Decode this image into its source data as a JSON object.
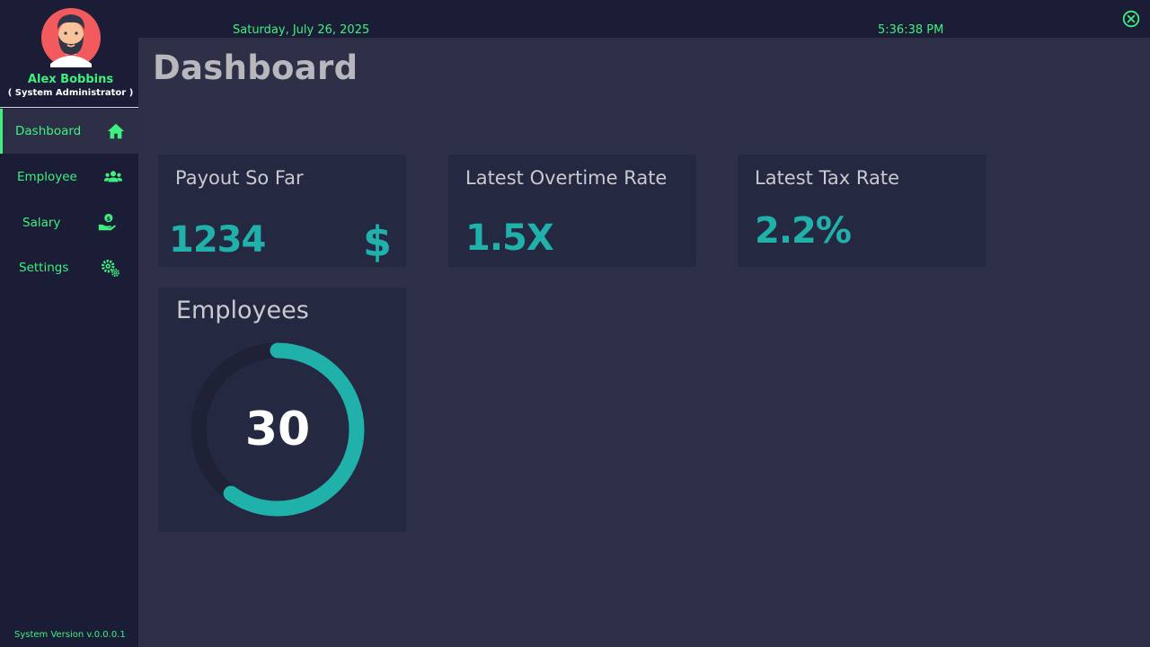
{
  "user": {
    "name": "Alex Bobbins",
    "role": "( System Administrator )"
  },
  "nav": {
    "items": [
      {
        "label": "Dashboard",
        "icon": "home-icon",
        "active": true
      },
      {
        "label": "Employee",
        "icon": "users-icon",
        "active": false
      },
      {
        "label": "Salary",
        "icon": "hand-money-icon",
        "active": false
      },
      {
        "label": "Settings",
        "icon": "gears-icon",
        "active": false
      }
    ]
  },
  "footer": {
    "version": "System Version v.0.0.0.1"
  },
  "topbar": {
    "date": "Saturday, July 26, 2025",
    "time": "5:36:38 PM",
    "close_icon": "close-circle-icon"
  },
  "page": {
    "title": "Dashboard"
  },
  "cards": {
    "payout": {
      "title": "Payout So Far",
      "value": "1234",
      "symbol": "$"
    },
    "overtime": {
      "title": "Latest Overtime Rate",
      "value": "1.5X"
    },
    "tax": {
      "title": "Latest Tax Rate",
      "value": "2.2%"
    },
    "employees": {
      "title": "Employees",
      "value": "30",
      "progress_fraction": 0.6
    }
  },
  "colors": {
    "accent_green": "#3ff07f",
    "accent_teal": "#20b2aa",
    "sidebar_bg": "#1b1d36",
    "main_bg": "#2d3047",
    "card_bg": "#252841"
  }
}
